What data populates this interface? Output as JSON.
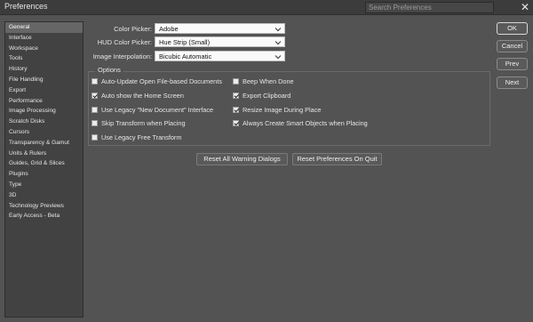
{
  "window": {
    "title": "Preferences",
    "close_symbol": "✕"
  },
  "search": {
    "placeholder": "Search Preferences"
  },
  "sidebar": {
    "items": [
      "General",
      "Interface",
      "Workspace",
      "Tools",
      "History",
      "File Handling",
      "Export",
      "Performance",
      "Image Processing",
      "Scratch Disks",
      "Cursors",
      "Transparency & Gamut",
      "Units & Rulers",
      "Guides, Grid & Slices",
      "Plugins",
      "Type",
      "3D",
      "Technology Previews",
      "Early Access - Beta"
    ],
    "active_index": 0
  },
  "fields": {
    "color_picker": {
      "label": "Color Picker:",
      "value": "Adobe"
    },
    "hud_color_picker": {
      "label": "HUD Color Picker:",
      "value": "Hue Strip (Small)"
    },
    "image_interpolation": {
      "label": "Image Interpolation:",
      "value": "Bicubic Automatic"
    }
  },
  "options": {
    "legend": "Options",
    "left": [
      {
        "label": "Auto-Update Open File-based Documents",
        "checked": false
      },
      {
        "label": "Auto show the Home Screen",
        "checked": true
      },
      {
        "label": "Use Legacy \"New Document\" Interface",
        "checked": false
      },
      {
        "label": "Skip Transform when Placing",
        "checked": false
      },
      {
        "label": "Use Legacy Free Transform",
        "checked": false
      }
    ],
    "right": [
      {
        "label": "Beep When Done",
        "checked": false
      },
      {
        "label": "Export Clipboard",
        "checked": true
      },
      {
        "label": "Resize Image During Place",
        "checked": true
      },
      {
        "label": "Always Create Smart Objects when Placing",
        "checked": true
      }
    ]
  },
  "buttons": {
    "reset_warnings": "Reset All Warning Dialogs",
    "reset_prefs": "Reset Preferences On Quit",
    "ok": "OK",
    "cancel": "Cancel",
    "prev": "Prev",
    "next": "Next"
  }
}
